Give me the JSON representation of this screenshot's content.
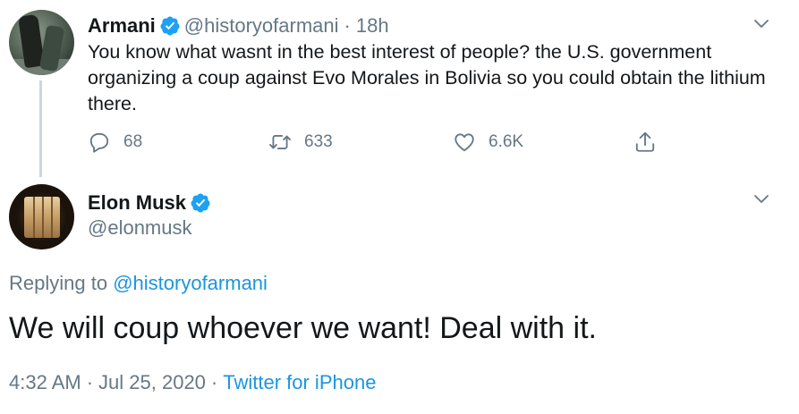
{
  "colors": {
    "accent": "#1b95e0",
    "verified": "#1da1f2",
    "secondary_text": "#657786",
    "primary_text": "#14171a",
    "thread_line": "#ccd6dd"
  },
  "parent_tweet": {
    "display_name": "Armani",
    "verified_icon": "verified-badge-icon",
    "handle": "@historyofarmani",
    "separator": "·",
    "time": "18h",
    "text": "You know what wasnt in the best interest of people? the U.S. government organizing a coup against Evo Morales in Bolivia so you could obtain the lithium there.",
    "actions": {
      "reply": {
        "icon": "reply-icon",
        "count": "68"
      },
      "retweet": {
        "icon": "retweet-icon",
        "count": "633"
      },
      "like": {
        "icon": "heart-icon",
        "count": "6.6K"
      },
      "share": {
        "icon": "share-icon"
      }
    },
    "menu_icon": "chevron-down-icon"
  },
  "main_tweet": {
    "display_name": "Elon Musk",
    "verified_icon": "verified-badge-icon",
    "handle": "@elonmusk",
    "menu_icon": "chevron-down-icon",
    "replying_prefix": "Replying to",
    "replying_to": "@historyofarmani",
    "text": "We will coup whoever we want! Deal with it.",
    "time": "4:32 AM",
    "dot1": "·",
    "date": "Jul 25, 2020",
    "dot2": "·",
    "source": "Twitter for iPhone"
  }
}
